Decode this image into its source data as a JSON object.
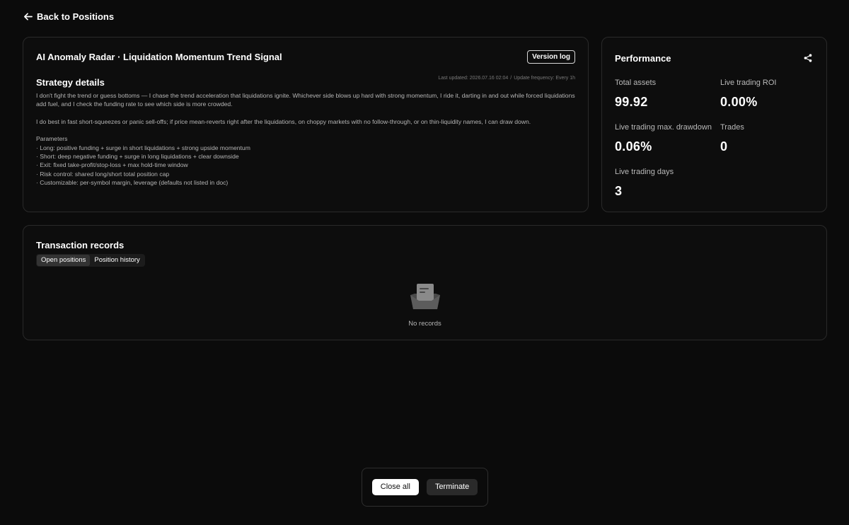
{
  "nav": {
    "back_label": "Back to Positions"
  },
  "strategy": {
    "title": "AI Anomaly Radar · Liquidation Momentum Trend Signal",
    "version_log_label": "Version log",
    "details_heading": "Strategy details",
    "last_updated": "Last updated: 2026.07.16 02:04",
    "meta_separator": "/",
    "update_frequency": "Update frequency: Every 1h",
    "paragraph_1": "I don't fight the trend or guess bottoms — I chase the trend acceleration that liquidations ignite. Whichever side blows up hard with strong momentum, I ride it, darting in and out while forced liquidations add fuel, and I check the funding rate to see which side is more crowded.",
    "paragraph_2": "I do best in fast short-squeezes or panic sell-offs; if price mean-reverts right after the liquidations, on choppy markets with no follow-through, or on thin-liquidity names, I can draw down.",
    "params_heading": "Parameters",
    "params": [
      "· Long: positive funding + surge in short liquidations + strong upside momentum",
      "· Short: deep negative funding + surge in long liquidations + clear downside",
      "· Exit: fixed take-profit/stop-loss + max hold-time window",
      "· Risk control: shared long/short total position cap",
      "· Customizable: per-symbol margin, leverage (defaults not listed in doc)"
    ]
  },
  "performance": {
    "title": "Performance",
    "share_icon": "share-icon",
    "metrics": [
      {
        "label": "Total assets",
        "value": "99.92"
      },
      {
        "label": "Live trading ROI",
        "value": "0.00%"
      },
      {
        "label": "Live trading max. drawdown",
        "value": "0.06%"
      },
      {
        "label": "Trades",
        "value": "0"
      },
      {
        "label": "Live trading days",
        "value": "3"
      }
    ]
  },
  "transactions": {
    "title": "Transaction records",
    "tabs": [
      {
        "label": "Open positions",
        "active": true
      },
      {
        "label": "Position history",
        "active": false
      }
    ],
    "empty_icon": "empty-box-icon",
    "empty_text": "No records"
  },
  "actions": {
    "close_all_label": "Close all",
    "terminate_label": "Terminate"
  },
  "colors": {
    "background": "#0b0b0b",
    "card_border": "#2a2a2a",
    "muted_text": "#b5b5b5",
    "primary_button": "#ffffff",
    "secondary_button": "#2a2a2a"
  }
}
